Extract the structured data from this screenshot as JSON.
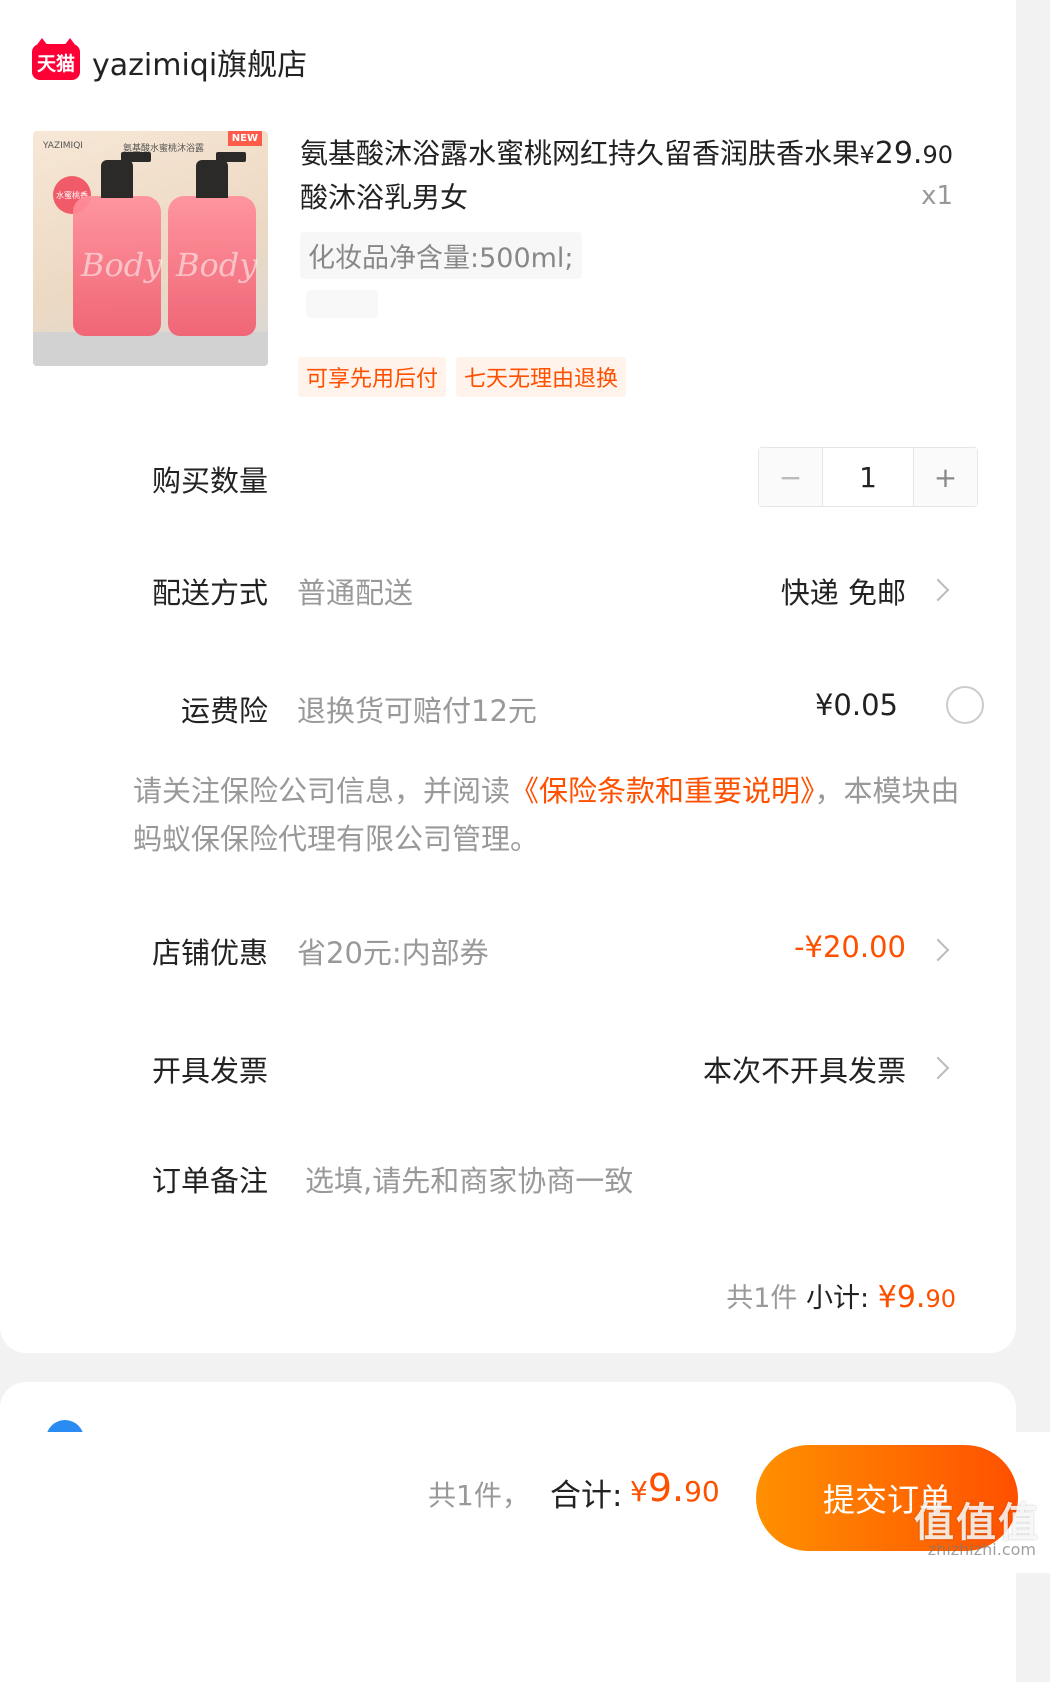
{
  "shop": {
    "badge": "天猫",
    "name": "yazimiqi旗舰店"
  },
  "product": {
    "image_brand": "YAZIMIQI",
    "image_caption": "氨基酸水蜜桃沐浴露",
    "image_new": "NEW",
    "image_body_text": "Body",
    "image_round_tag": "水蜜桃香",
    "title": "氨基酸沐浴露水蜜桃网红持久留香润肤香水果酸沐浴乳男女",
    "price_yen": "¥",
    "price_int": "29.",
    "price_cents": "90",
    "quantity_label": "x1",
    "sku": "化妆品净含量:500ml;",
    "tags": [
      "可享先用后付",
      "七天无理由退换"
    ]
  },
  "quantity": {
    "label": "购买数量",
    "minus": "−",
    "value": "1",
    "plus": "+"
  },
  "delivery": {
    "label": "配送方式",
    "sub": "普通配送",
    "value": "快递 免邮"
  },
  "insurance": {
    "label": "运费险",
    "sub": "退换货可赔付12元",
    "value": "¥0.05"
  },
  "notice": {
    "text1": "请关注保险公司信息，并阅读",
    "link": "《保险条款和重要说明》",
    "text2": "，本模块由蚂蚁保保险代理有限公司管理。"
  },
  "coupon": {
    "label": "店铺优惠",
    "sub": "省20元:内部券",
    "value": "-¥20.00"
  },
  "invoice": {
    "label": "开具发票",
    "value": "本次不开具发票"
  },
  "remark": {
    "label": "订单备注",
    "placeholder": "选填,请先和商家协商一致"
  },
  "subtotal": {
    "count": "共1件",
    "label": "小计:",
    "yen": "¥",
    "int": "9.",
    "cents": "90"
  },
  "footer": {
    "count": "共1件，",
    "label": "合计:",
    "yen": "¥",
    "int": "9.",
    "cents": "90",
    "submit": "提交订单"
  },
  "watermark": {
    "main": "值值值",
    "sub": "zhizhizhi.com"
  },
  "colors": {
    "accent": "#ff5000",
    "tmall": "#ff0036"
  }
}
